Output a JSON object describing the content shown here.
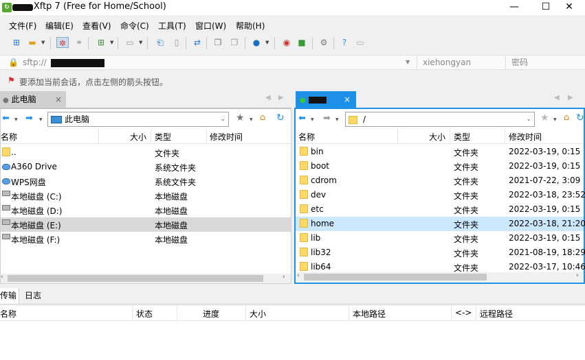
{
  "window": {
    "title": "- Xftp 7 (Free for Home/School)",
    "minimize_label": "—",
    "maximize_label": "☐",
    "close_label": "✕"
  },
  "menu": [
    "文件(F)",
    "编辑(E)",
    "查看(V)",
    "命令(C)",
    "工具(T)",
    "窗口(W)",
    "帮助(H)"
  ],
  "address": {
    "protocol": "sftp://",
    "username": "xiehongyan",
    "password_placeholder": "密码"
  },
  "hint": "要添加当前会话，点击左侧的箭头按钮。",
  "left_panel": {
    "tab_label": "此电脑",
    "tab_close": "×",
    "path": "此电脑",
    "columns": [
      "名称",
      "大小",
      "类型",
      "修改时间"
    ],
    "rows": [
      {
        "name": "..",
        "size": "",
        "type": "文件夹",
        "modified": "",
        "icon": "folder"
      },
      {
        "name": "A360 Drive",
        "size": "",
        "type": "系统文件夹",
        "modified": "",
        "icon": "cloud"
      },
      {
        "name": "WPS网盘",
        "size": "",
        "type": "系统文件夹",
        "modified": "",
        "icon": "cloud"
      },
      {
        "name": "本地磁盘 (C:)",
        "size": "",
        "type": "本地磁盘",
        "modified": "",
        "icon": "drive"
      },
      {
        "name": "本地磁盘 (D:)",
        "size": "",
        "type": "本地磁盘",
        "modified": "",
        "icon": "drive"
      },
      {
        "name": "本地磁盘 (E:)",
        "size": "",
        "type": "本地磁盘",
        "modified": "",
        "icon": "drive",
        "selected": true
      },
      {
        "name": "本地磁盘 (F:)",
        "size": "",
        "type": "本地磁盘",
        "modified": "",
        "icon": "drive"
      }
    ]
  },
  "right_panel": {
    "tab_close": "×",
    "path": "/",
    "columns": [
      "名称",
      "大小",
      "类型",
      "修改时间"
    ],
    "rows": [
      {
        "name": "bin",
        "type": "文件夹",
        "modified": "2022-03-19, 0:15"
      },
      {
        "name": "boot",
        "type": "文件夹",
        "modified": "2022-03-19, 0:15"
      },
      {
        "name": "cdrom",
        "type": "文件夹",
        "modified": "2021-07-22, 3:09"
      },
      {
        "name": "dev",
        "type": "文件夹",
        "modified": "2022-03-18, 23:52"
      },
      {
        "name": "etc",
        "type": "文件夹",
        "modified": "2022-03-19, 0:15"
      },
      {
        "name": "home",
        "type": "文件夹",
        "modified": "2022-03-18, 21:20",
        "selected": true
      },
      {
        "name": "lib",
        "type": "文件夹",
        "modified": "2022-03-19, 0:15"
      },
      {
        "name": "lib32",
        "type": "文件夹",
        "modified": "2021-08-19, 18:29"
      },
      {
        "name": "lib64",
        "type": "文件夹",
        "modified": "2022-03-17, 10:46"
      }
    ]
  },
  "bottom": {
    "tabs": [
      "传输",
      "日志"
    ],
    "columns": [
      "名称",
      "状态",
      "进度",
      "大小",
      "本地路径",
      "<->",
      "远程路径"
    ]
  },
  "colors": {
    "accent": "#1e90e8",
    "selection_left": "#d9d9d9",
    "selection_right": "#cce8ff"
  }
}
